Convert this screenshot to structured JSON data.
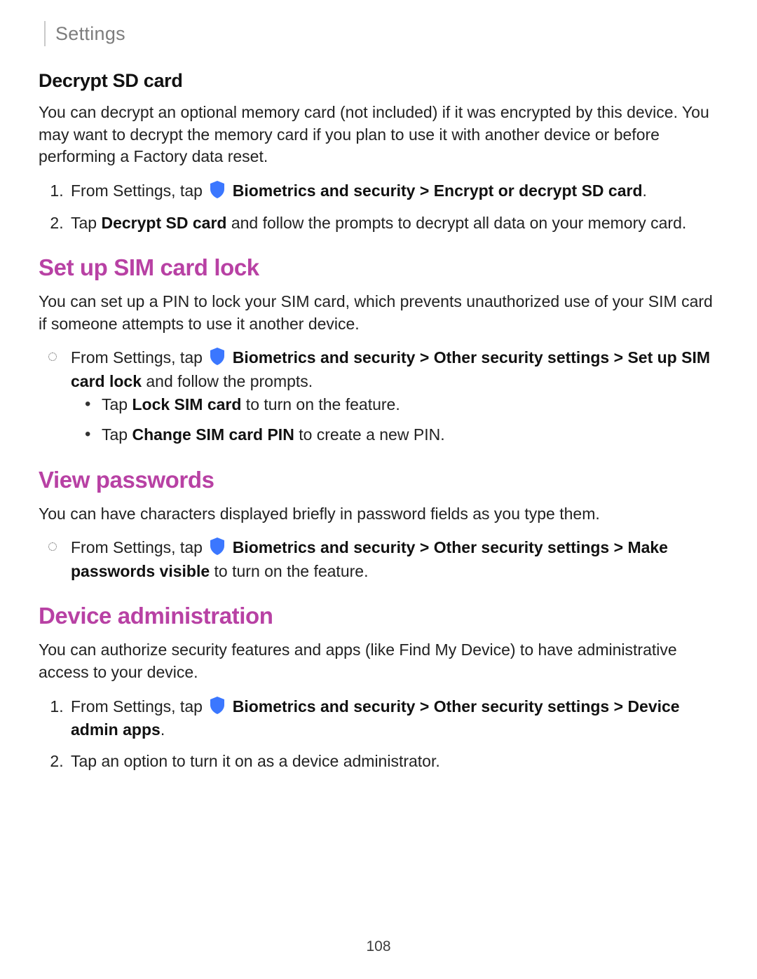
{
  "header": {
    "title": "Settings"
  },
  "pageNumber": "108",
  "glyphs": {
    "chevron": ">"
  },
  "sections": {
    "decrypt": {
      "heading": "Decrypt SD card",
      "intro": "You can decrypt an optional memory card (not included) if it was encrypted by this device. You may want to decrypt the memory card if you plan to use it with another device or before performing a Factory data reset.",
      "step1_pre": "From Settings, tap ",
      "step1_b1": "Biometrics and security",
      "step1_b2": "Encrypt or decrypt SD card",
      "step1_post": ".",
      "step2_pre": "Tap ",
      "step2_b1": "Decrypt SD card",
      "step2_post": " and follow the prompts to decrypt all data on your memory card."
    },
    "simlock": {
      "heading": "Set up SIM card lock",
      "intro": "You can set up a PIN to lock your SIM card, which prevents unauthorized use of your SIM card if someone attempts to use it another device.",
      "ob1_pre": "From Settings, tap ",
      "ob1_b1": "Biometrics and security",
      "ob1_b2": "Other security settings",
      "ob1_b3": "Set up SIM card lock",
      "ob1_post": " and follow the prompts.",
      "sub1_pre": "Tap ",
      "sub1_b1": "Lock SIM card",
      "sub1_post": " to turn on the feature.",
      "sub2_pre": "Tap ",
      "sub2_b1": "Change SIM card PIN",
      "sub2_post": " to create a new PIN."
    },
    "viewpw": {
      "heading": "View passwords",
      "intro": "You can have characters displayed briefly in password fields as you type them.",
      "ob1_pre": "From Settings, tap ",
      "ob1_b1": "Biometrics and security",
      "ob1_b2": "Other security settings",
      "ob1_b3": "Make passwords visible",
      "ob1_post": " to turn on the feature."
    },
    "devadmin": {
      "heading": "Device administration",
      "intro": "You can authorize security features and apps (like Find My Device) to have administrative access to your device.",
      "step1_pre": "From Settings, tap ",
      "step1_b1": "Biometrics and security",
      "step1_b2": "Other security settings",
      "step1_b3": "Device admin apps",
      "step1_post": ".",
      "step2": "Tap an option to turn it on as a device administrator."
    }
  }
}
